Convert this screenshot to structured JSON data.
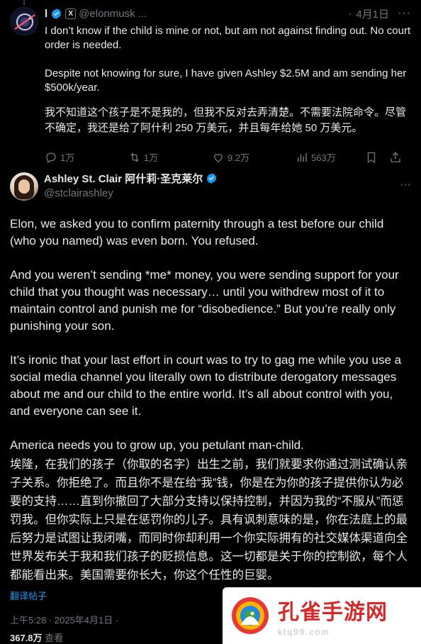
{
  "reply": {
    "author_name": "l",
    "x_badge": "X",
    "handle": "@elonmusk ...",
    "separator": "·",
    "date": "4月1日",
    "more": "···",
    "paragraphs": [
      "I don’t know if the child is mine or not, but am not against finding out. No court order is needed.",
      "Despite not knowing for sure, I have given Ashley $2.5M and am sending her $500k/year."
    ],
    "translation": "我不知道这个孩子是不是我的，但我不反对去弄清楚。不需要法院命令。尽管不确定，我还是给了阿什利 250 万美元，并且每年给她 50 万美元。",
    "stats": {
      "replies": "1万",
      "retweets": "1万",
      "likes": "9.2万",
      "views": "563万"
    }
  },
  "main": {
    "author_name": "Ashley St. Clair 阿什莉·圣克莱尔",
    "handle": "@stclairashley",
    "more": "···",
    "paragraphs": [
      "Elon, we asked you to confirm paternity through a test before our child (who you named) was even born. You refused.",
      "And you weren’t sending *me* money, you were sending support for your child that you thought was necessary… until you withdrew most of it to maintain control and punish me for “disobedience.” But you’re really only punishing your son.",
      "It’s ironic that your last effort in court was to try to gag me while you use a social media channel you literally own to distribute derogatory messages about me and our child to the entire world. It’s all about control with you, and everyone can see it.",
      "America needs you to grow up, you petulant man-child."
    ],
    "translation": "埃隆，在我们的孩子（你取的名字）出生之前，我们就要求你通过测试确认亲子关系。你拒绝了。而且你不是在给“我”钱，你是在为你的孩子提供你认为必要的支持……直到你撤回了大部分支持以保持控制，并因为我的“不服从”而惩罚我。但你实际上只是在惩罚你的儿子。具有讽刺意味的是，你在法庭上的最后努力是试图让我闭嘴，而同时你却利用一个你实际拥有的社交媒体渠道向全世界发布关于我和我们孩子的贬损信息。这一切都是关于你的控制欲，每个人都能看出来。美国需要你长大，你这个任性的巨婴。",
    "translate_link": "翻译帖子",
    "timestamp": "上午5:28 · 2025年4月1日 ·",
    "views_count": "367.8万",
    "views_label": "查看"
  },
  "watermark": {
    "title": "孔雀手游网",
    "url": "ktq99.com"
  },
  "colors": {
    "background": "#000000",
    "text": "#e7e9ea",
    "muted": "#71767b",
    "link": "#1d9bf0",
    "verified": "#1d9bf0",
    "watermark_red": "#d32b2b"
  },
  "icons": {
    "reply": "reply-icon",
    "retweet": "retweet-icon",
    "like": "heart-icon",
    "views": "analytics-icon",
    "bookmark": "bookmark-icon",
    "share": "share-icon",
    "verified": "verified-badge-icon"
  }
}
